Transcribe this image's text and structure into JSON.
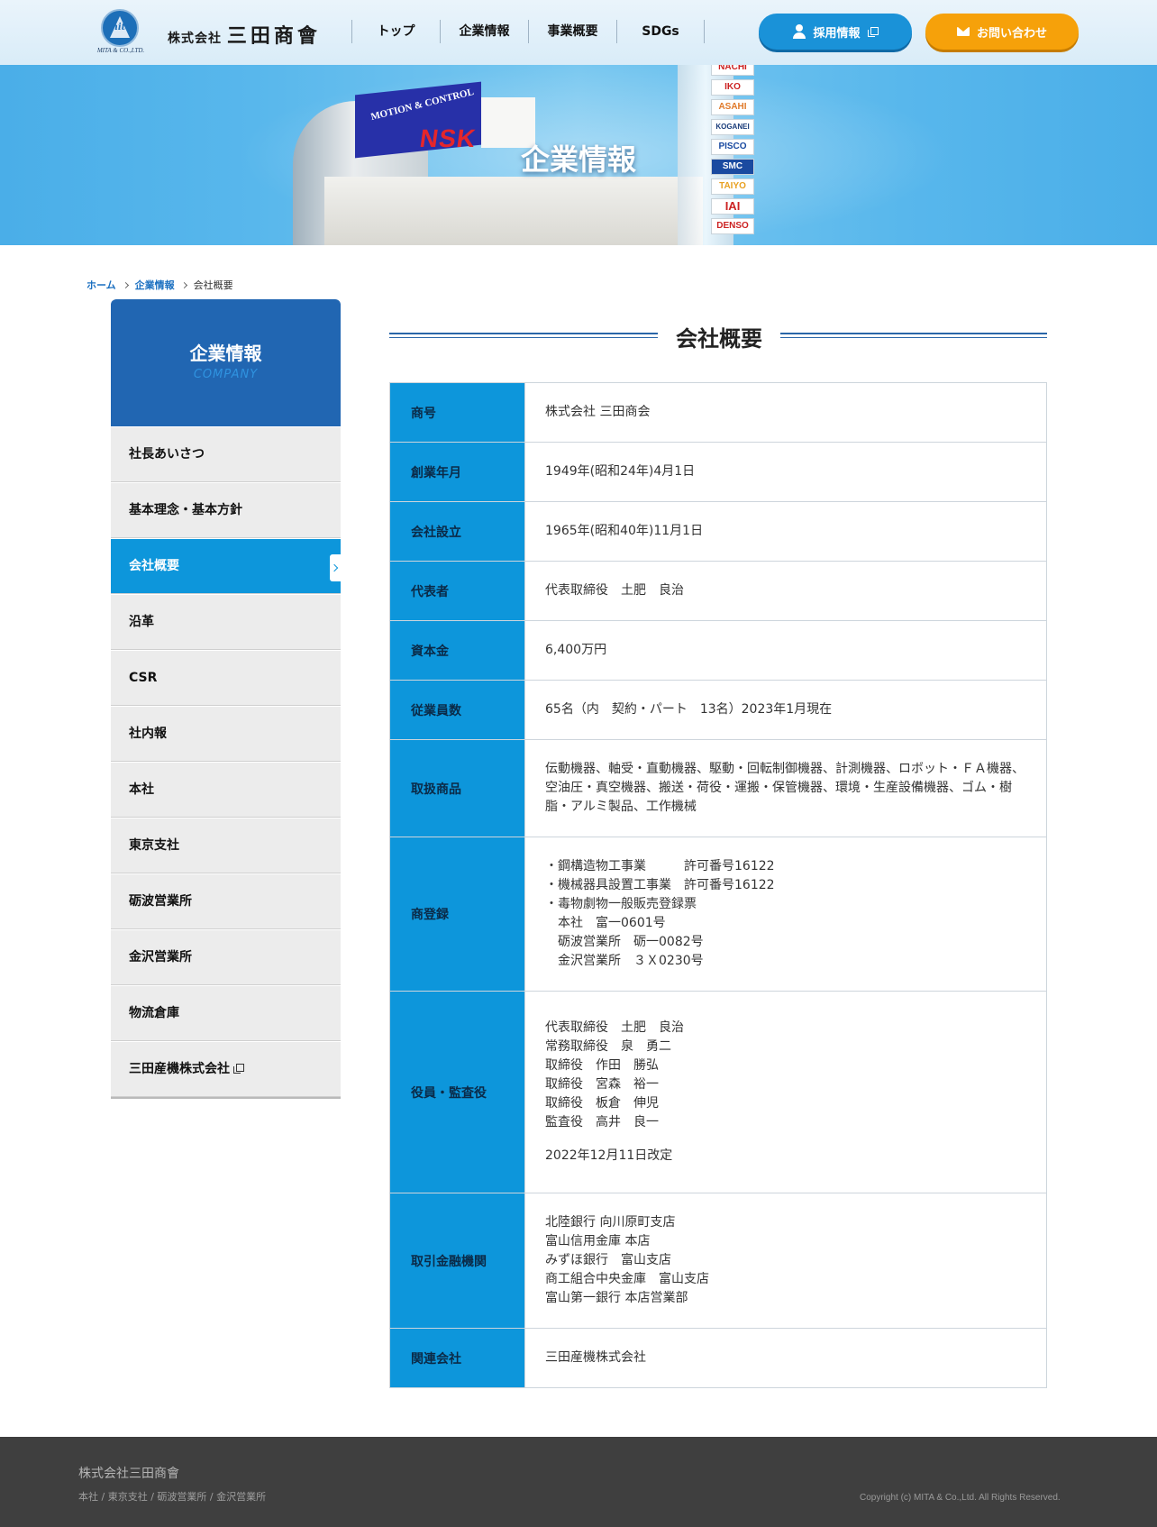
{
  "header": {
    "logo_text": "mita",
    "logo_sub": "MITA & CO.,LTD.",
    "company_prefix": "株式会社",
    "company_name": "三田商會",
    "nav": [
      "トップ",
      "企業情報",
      "事業概要",
      "SDGs"
    ],
    "recruit_label": "採用情報",
    "contact_label": "お問い合わせ",
    "recruit_color": "#1a92d8",
    "contact_color": "#f6a10a"
  },
  "hero": {
    "title": "企業情報",
    "sign_motion": "MOTION & CONTROL",
    "sign_brand": "NSK",
    "pole_brands": [
      "NACHI",
      "IKO",
      "ASAHI",
      "KOGANEI",
      "PISCO",
      "SMC",
      "TAIYO",
      "IAI",
      "DENSO"
    ]
  },
  "breadcrumb": {
    "home": "ホーム",
    "parent": "企業情報",
    "current": "会社概要"
  },
  "sidebar": {
    "title": "企業情報",
    "subtitle": "COMPANY",
    "items": [
      {
        "label": "社長あいさつ"
      },
      {
        "label": "基本理念・基本方針"
      },
      {
        "label": "会社概要"
      },
      {
        "label": "沿革"
      },
      {
        "label": "CSR"
      },
      {
        "label": "社内報"
      },
      {
        "label": "本社"
      },
      {
        "label": "東京支社"
      },
      {
        "label": "砺波営業所"
      },
      {
        "label": "金沢営業所"
      },
      {
        "label": "物流倉庫"
      },
      {
        "label": "三田産機株式会社"
      }
    ],
    "active_index": 2
  },
  "main": {
    "title": "会社概要",
    "rows": [
      {
        "label": "商号",
        "lines": [
          "株式会社 三田商会"
        ]
      },
      {
        "label": "創業年月",
        "lines": [
          "1949年(昭和24年)4月1日"
        ]
      },
      {
        "label": "会社設立",
        "lines": [
          "1965年(昭和40年)11月1日"
        ]
      },
      {
        "label": "代表者",
        "lines": [
          "代表取締役　土肥　良治"
        ]
      },
      {
        "label": "資本金",
        "lines": [
          "6,400万円"
        ]
      },
      {
        "label": "従業員数",
        "lines": [
          "65名（内　契約・パート　13名）2023年1月現在"
        ]
      },
      {
        "label": "取扱商品",
        "lines": [
          "伝動機器、軸受・直動機器、駆動・回転制御機器、計測機器、ロボット・ＦＡ機器、",
          "空油圧・真空機器、搬送・荷役・運搬・保管機器、環境・生産設備機器、ゴム・樹",
          "脂・アルミ製品、工作機械"
        ]
      },
      {
        "label": "商登録",
        "lines": [
          "・鋼構造物工事業　　　許可番号16122",
          "・機械器具設置工事業　許可番号16122",
          "・毒物劇物一般販売登録票",
          "　本社　富一0601号",
          "　砺波営業所　砺一0082号",
          "　金沢営業所　３Ｘ0230号"
        ]
      },
      {
        "label": "役員・監査役",
        "lines": [
          "代表取締役　土肥　良治",
          "常務取締役　泉　勇二",
          "取締役　作田　勝弘",
          "取締役　宮森　裕一",
          "取締役　板倉　伸児",
          "監査役　高井　良一"
        ],
        "note": "2022年12月11日改定"
      },
      {
        "label": "取引金融機関",
        "lines": [
          "北陸銀行 向川原町支店",
          "富山信用金庫 本店",
          "みずほ銀行　富山支店",
          "商工組合中央金庫　富山支店",
          "富山第一銀行 本店営業部"
        ]
      },
      {
        "label": "関連会社",
        "lines": [
          "三田産機株式会社"
        ]
      }
    ]
  },
  "footer": {
    "company": "株式会社三田商會",
    "links": "本社 / 東京支社 / 砺波営業所 / 金沢営業所",
    "copyright": "Copyright (c) MITA & Co.,Ltd. All Rights Reserved."
  }
}
